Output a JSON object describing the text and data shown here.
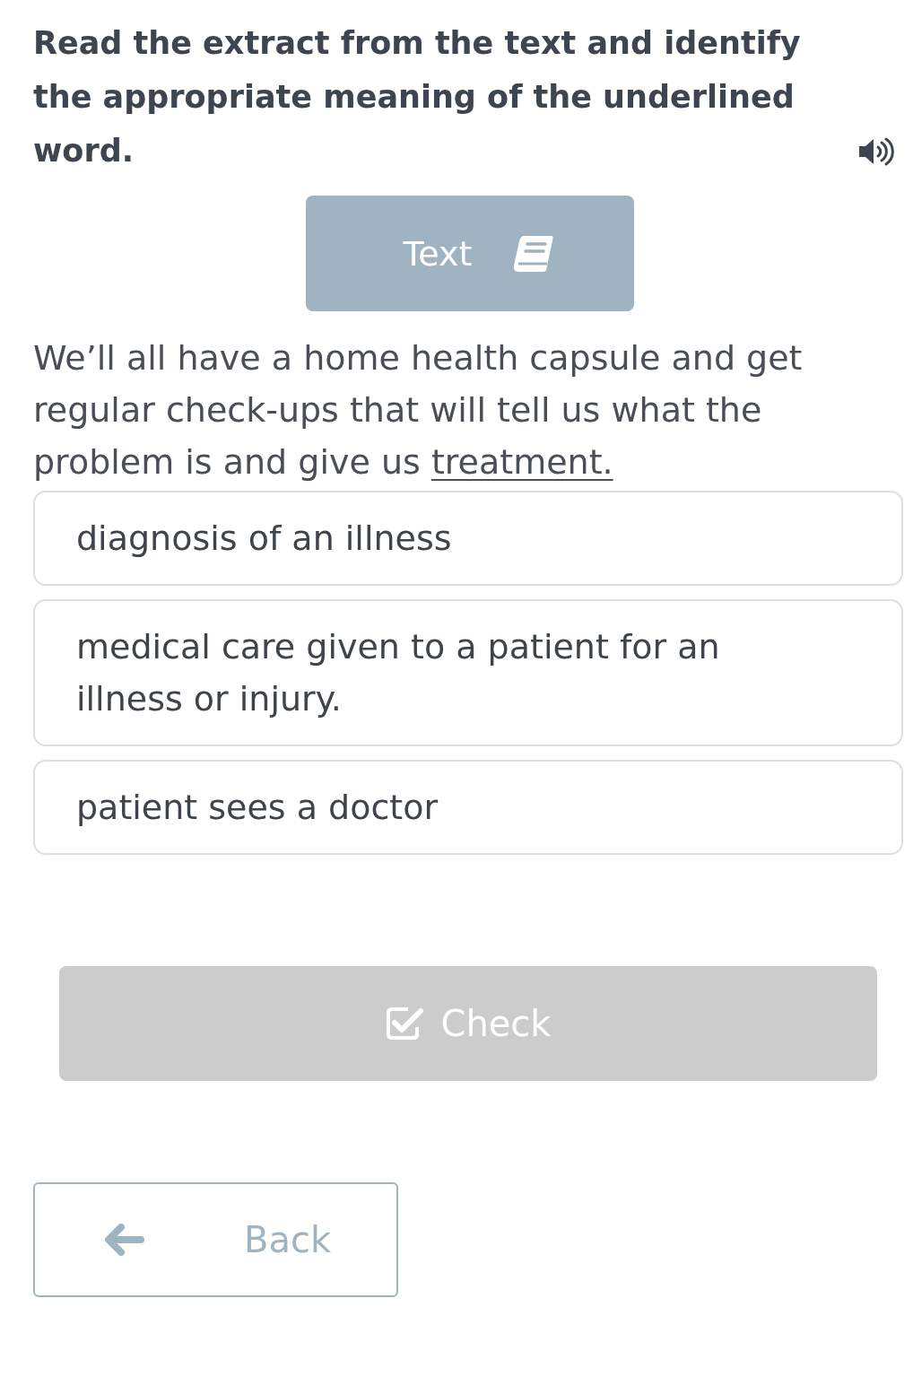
{
  "instruction": {
    "text": "Read the extract from the text and identify the appropriate meaning of the underlined word."
  },
  "text_button": {
    "label": "Text"
  },
  "passage": {
    "before": "We’ll all have a home health capsule and get regular check-ups that will tell us what the problem is and give us ",
    "underlined": "treatment."
  },
  "options": [
    {
      "label": "diagnosis of an illness",
      "selected": false
    },
    {
      "label": "medical care given to a patient for an illness or injury.",
      "selected": false
    },
    {
      "label": "patient sees a doctor",
      "selected": false
    }
  ],
  "check_button": {
    "label": "Check",
    "disabled": true
  },
  "back_button": {
    "label": "Back"
  }
}
